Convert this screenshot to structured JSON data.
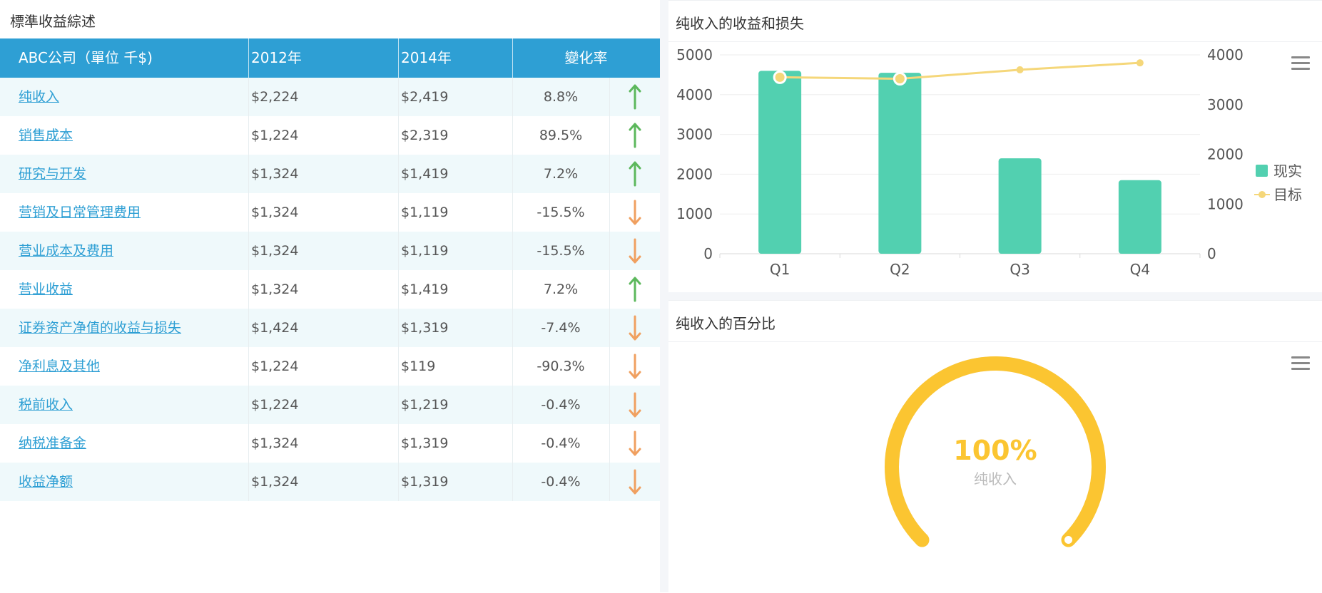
{
  "left": {
    "title": "標準收益綜述",
    "headers": [
      "ABC公司（單位 千$)",
      "2012年",
      "2014年",
      "變化率"
    ],
    "rows": [
      {
        "name": "纯收入",
        "y2012": "$2,224",
        "y2014": "$2,419",
        "rate": "8.8%",
        "dir": "up"
      },
      {
        "name": "销售成本",
        "y2012": "$1,224",
        "y2014": "$2,319",
        "rate": "89.5%",
        "dir": "up"
      },
      {
        "name": "研究与开发",
        "y2012": "$1,324",
        "y2014": "$1,419",
        "rate": "7.2%",
        "dir": "up"
      },
      {
        "name": "营销及日常管理费用",
        "y2012": "$1,324",
        "y2014": "$1,119",
        "rate": "-15.5%",
        "dir": "down"
      },
      {
        "name": "营业成本及费用",
        "y2012": "$1,324",
        "y2014": "$1,119",
        "rate": "-15.5%",
        "dir": "down"
      },
      {
        "name": "营业收益",
        "y2012": "$1,324",
        "y2014": "$1,419",
        "rate": "7.2%",
        "dir": "up"
      },
      {
        "name": "证券资产净值的收益与损失",
        "y2012": "$1,424",
        "y2014": "$1,319",
        "rate": "-7.4%",
        "dir": "down"
      },
      {
        "name": "净利息及其他",
        "y2012": "$1,224",
        "y2014": "$119",
        "rate": "-90.3%",
        "dir": "down"
      },
      {
        "name": "税前收入",
        "y2012": "$1,224",
        "y2014": "$1,219",
        "rate": "-0.4%",
        "dir": "down"
      },
      {
        "name": "纳税准备金",
        "y2012": "$1,324",
        "y2014": "$1,319",
        "rate": "-0.4%",
        "dir": "down"
      },
      {
        "name": "收益净额",
        "y2012": "$1,324",
        "y2014": "$1,319",
        "rate": "-0.4%",
        "dir": "down"
      }
    ],
    "colors": {
      "header": "#2e9fd4",
      "up": "#5cb85c",
      "down": "#f0a060",
      "link": "#2e9fd4"
    }
  },
  "top_panel": {
    "title": "纯收入的收益和损失",
    "menu_icon": "hamburger-menu-icon"
  },
  "bottom_panel": {
    "title": "纯收入的百分比",
    "menu_icon": "hamburger-menu-icon"
  },
  "chart_data": [
    {
      "type": "bar",
      "categories": [
        "Q1",
        "Q2",
        "Q3",
        "Q4"
      ],
      "series": [
        {
          "name": "现实",
          "type": "bar",
          "axis": "left",
          "values": [
            4600,
            4550,
            2400,
            1850
          ],
          "color": "#52d0b0"
        },
        {
          "name": "目标",
          "type": "line",
          "axis": "right",
          "values": [
            3550,
            3520,
            3700,
            3840
          ],
          "color": "#f5d77a"
        }
      ],
      "yleft": {
        "ticks": [
          "0",
          "1000",
          "2000",
          "3000",
          "4000",
          "5000"
        ],
        "ylim": [
          0,
          5000
        ]
      },
      "yright": {
        "ticks": [
          "0",
          "1000",
          "2000",
          "3000",
          "4000"
        ],
        "ylim": [
          0,
          4000
        ]
      },
      "legend_position": "right",
      "grid": true
    },
    {
      "type": "gauge",
      "value": 100,
      "value_label": "100%",
      "label": "纯收入",
      "color": "#fbc531",
      "track_color": "#e8e8e8"
    }
  ]
}
